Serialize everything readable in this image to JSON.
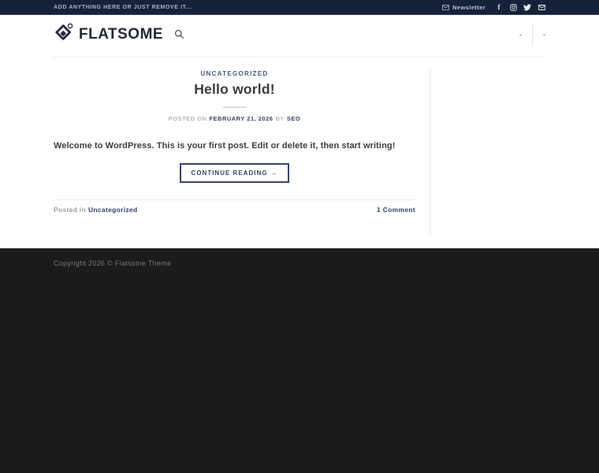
{
  "topbar": {
    "left_text": "ADD ANYTHING HERE OR JUST REMOVE IT...",
    "newsletter_label": "Newsletter",
    "social_icons": [
      "facebook",
      "instagram",
      "twitter",
      "email"
    ]
  },
  "header": {
    "logo_text": "FLATSOME",
    "search_icon": "magnifier",
    "nav_items": [
      "-",
      "-"
    ]
  },
  "post": {
    "category": "UNCATEGORIZED",
    "title": "Hello world!",
    "meta": {
      "posted_on_label": "POSTED ON",
      "date": "FEBRUARY 21, 2026",
      "by_label": "BY",
      "author": "SEO"
    },
    "excerpt": "Welcome to WordPress. This is your first post. Edit or delete it, then start writing!",
    "continue_label": "CONTINUE READING",
    "continue_arrow": "→",
    "footer_meta": {
      "posted_in_label": "Posted in",
      "category_link": "Uncategorized",
      "comments": "1 Comment"
    }
  },
  "footer": {
    "copyright": "Copyright 2026 © Flatsome Theme"
  },
  "colors": {
    "topbar_bg": "#16213a",
    "primary_link": "#32466b",
    "category_link": "#44597f",
    "footer_bg": "#1b1b1b",
    "header_bg": "#ffffff",
    "logo_color": "#23283a"
  }
}
